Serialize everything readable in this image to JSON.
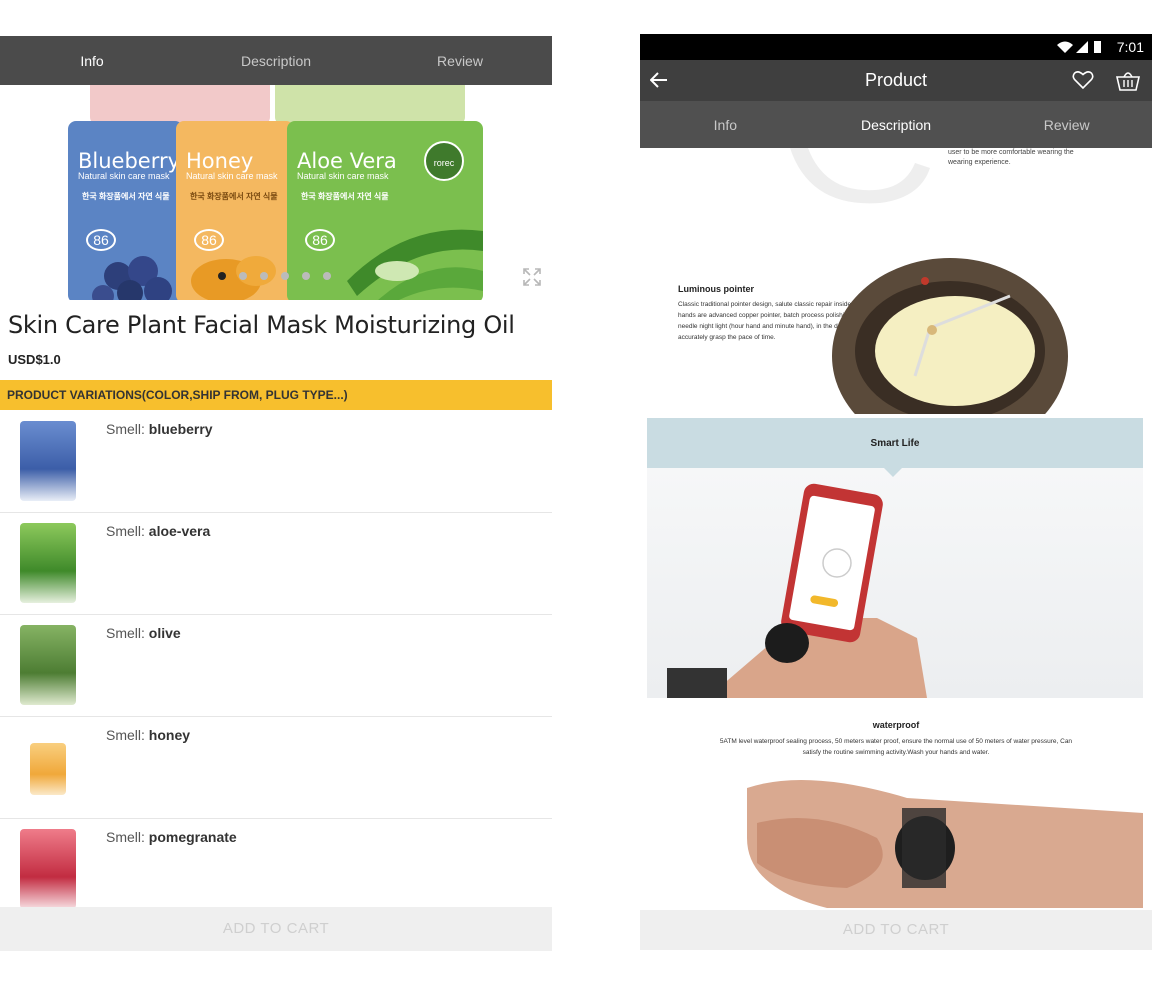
{
  "left_screen": {
    "tabs": [
      {
        "label": "Info",
        "active": true
      },
      {
        "label": "Description",
        "active": false
      },
      {
        "label": "Review",
        "active": false
      }
    ],
    "gallery": {
      "packs": [
        {
          "name": "Blueberry",
          "subtitle": "Natural skin care mask",
          "color": "#5b84c4"
        },
        {
          "name": "Honey",
          "subtitle": "Natural skin care mask",
          "color": "#f4b860"
        },
        {
          "name": "Aloe Vera",
          "subtitle": "Natural skin care mask",
          "color": "#7bbf4e"
        }
      ],
      "korean_text": "한국 화장품에서 자연 식물",
      "badge": "86",
      "brand": "rorec",
      "dots_count": 6,
      "active_dot": 1,
      "expand_icon": "expand-icon"
    },
    "product": {
      "title": "Skin Care Plant Facial Mask Moisturizing Oil",
      "price": "USD$1.0"
    },
    "variations_header": "PRODUCT VARIATIONS(COLOR,SHIP FROM, PLUG TYPE...)",
    "variation_prefix": "Smell: ",
    "variations": [
      {
        "value": "blueberry",
        "color": "#4f6fb8"
      },
      {
        "value": "aloe-vera",
        "color": "#6aa64a"
      },
      {
        "value": "olive",
        "color": "#6f9e4c"
      },
      {
        "value": "honey",
        "color": "#f3b44e"
      },
      {
        "value": "pomegranate",
        "color": "#d94a5a"
      }
    ],
    "add_to_cart": "ADD TO CART"
  },
  "right_screen": {
    "status": {
      "time": "7:01",
      "icons": [
        "wifi-icon",
        "signal-icon",
        "battery-icon"
      ]
    },
    "app_bar": {
      "title": "Product",
      "back_icon": "back-arrow-icon",
      "heart_icon": "heart-icon",
      "cart_icon": "basket-icon"
    },
    "tabs": [
      {
        "label": "Info",
        "active": false
      },
      {
        "label": "Description",
        "active": true
      },
      {
        "label": "Review",
        "active": false
      }
    ],
    "description": {
      "top_text": "user to be more comfortable wearing the wearing experience.",
      "luminous_title": "Luminous pointer",
      "luminous_body": "Classic traditional pointer design, salute classic repair inside. All hands are advanced copper pointer, batch process polishing. Double needle night light (hour hand and minute hand), in the dark can also accurately grasp the pace of time.",
      "smart_life": "Smart Life",
      "waterproof_title": "waterproof",
      "waterproof_body": "5ATM level waterproof sealing process, 50 meters water proof, ensure the normal use of 50 meters of water pressure, Can satisfy the routine swimming activity.Wash your hands and water."
    },
    "add_to_cart": "ADD TO CART"
  }
}
